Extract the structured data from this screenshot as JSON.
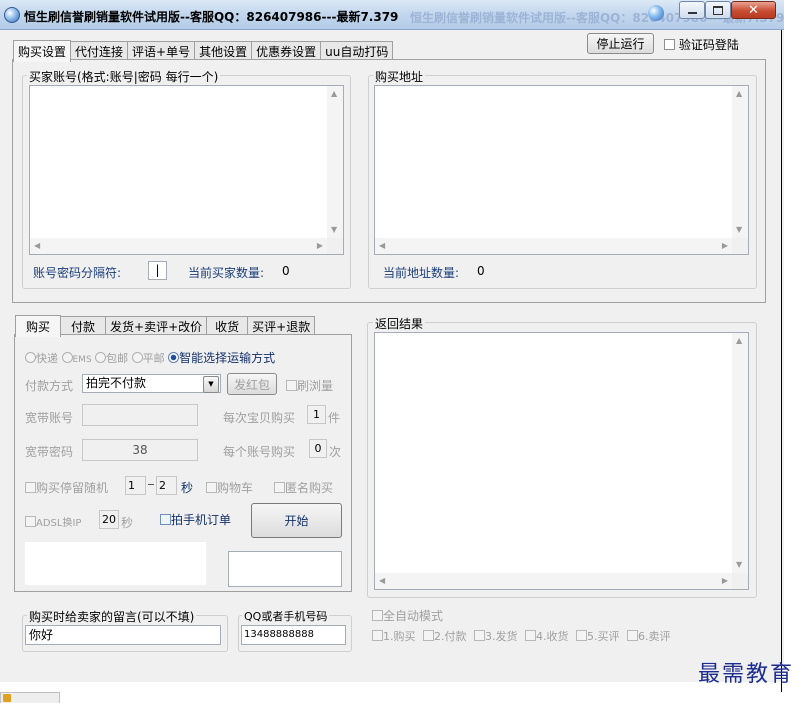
{
  "window": {
    "title": "恒生刷信誉刷销量软件试用版--客服QQ：826407986---最新7.379",
    "ghost_title": "恒生刷信誉刷销量软件试用版--客服QQ：826407986---最新7.379"
  },
  "top_tabs": [
    "购买设置",
    "代付连接",
    "评语+单号",
    "其他设置",
    "优惠券设置",
    "uu自动打码"
  ],
  "toolbar": {
    "stop_label": "停止运行",
    "captcha_login_label": "验证码登陆"
  },
  "buyer_accounts": {
    "label": "买家账号(格式:账号|密码 每行一个)",
    "separator_label": "账号密码分隔符:",
    "separator_value": "|",
    "count_label": "当前买家数量:",
    "count_value": "0"
  },
  "buy_address": {
    "label": "购买地址",
    "count_label": "当前地址数量:",
    "count_value": "0"
  },
  "sub_tabs": [
    "购买",
    "付款",
    "发货+卖评+改价",
    "收货",
    "买评+退款"
  ],
  "shipping": {
    "options": [
      "快递",
      "EMS",
      "包邮",
      "平邮"
    ],
    "smart_label": "智能选择运输方式"
  },
  "payment": {
    "label": "付款方式",
    "selected": "拍完不付款",
    "red_packet_label": "发红包",
    "browse_label": "刷浏量"
  },
  "broadband": {
    "account_label": "宽带账号",
    "account_value": "",
    "password_label": "宽带密码",
    "password_value": "38"
  },
  "per_item": {
    "label": "每次宝贝购买",
    "value": "1",
    "unit": "件"
  },
  "per_account": {
    "label": "每个账号购买",
    "value": "0",
    "unit": "次"
  },
  "random_stay": {
    "label": "购买停留随机",
    "min": "1",
    "max": "2",
    "unit": "秒"
  },
  "cart_label": "购物车",
  "anonymous_label": "匿名购买",
  "adsl": {
    "label": "ADSL换IP",
    "value": "20",
    "unit": "秒"
  },
  "phone_order_label": "拍手机订单",
  "start_label": "开始",
  "results_label": "返回结果",
  "message": {
    "label": "购买时给卖家的留言(可以不填)",
    "value": "你好"
  },
  "qq_phone": {
    "label": "QQ或者手机号码",
    "value": "13488888888"
  },
  "auto_mode": {
    "label": "全自动模式",
    "steps": [
      "1.购买",
      "2.付款",
      "3.发货",
      "4.收货",
      "5.买评",
      "6.卖评"
    ]
  },
  "watermark": "最需教育",
  "colors": {
    "titlebar": "#c4d8ee",
    "close_button": "#c94d33",
    "selected_radio": "#1f4f9a",
    "watermark": "#1c2d8f"
  }
}
